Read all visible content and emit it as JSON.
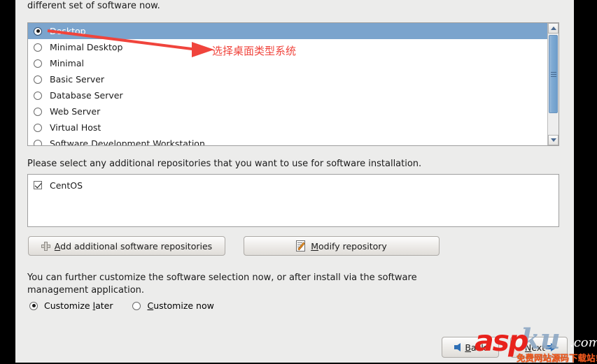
{
  "intro_text": "different set of software now.",
  "software_groups": {
    "items": [
      {
        "label": "Desktop",
        "selected": true
      },
      {
        "label": "Minimal Desktop",
        "selected": false
      },
      {
        "label": "Minimal",
        "selected": false
      },
      {
        "label": "Basic Server",
        "selected": false
      },
      {
        "label": "Database Server",
        "selected": false
      },
      {
        "label": "Web Server",
        "selected": false
      },
      {
        "label": "Virtual Host",
        "selected": false
      },
      {
        "label": "Software Development Workstation",
        "selected": false
      }
    ],
    "scrollbar": {
      "up_icon": "chevron-up-icon",
      "down_icon": "chevron-down-icon"
    }
  },
  "annotation": {
    "text": "选择桌面类型系统",
    "color": "#f0443c",
    "arrow_icon": "red-arrow-icon"
  },
  "repositories": {
    "label": "Please select any additional repositories that you want to use for software installation.",
    "items": [
      {
        "label": "CentOS",
        "checked": true
      }
    ]
  },
  "buttons": {
    "add_repo": {
      "accel": "A",
      "rest": "dd additional software repositories",
      "icon": "plus-icon"
    },
    "modify_repo": {
      "accel": "M",
      "rest": "odify repository",
      "icon": "document-edit-icon"
    },
    "back": {
      "accel": "B",
      "rest": "ack",
      "pre": "",
      "icon": "arrow-left-icon"
    },
    "next": {
      "accel": "N",
      "rest": "ext",
      "icon": "arrow-right-icon"
    }
  },
  "customize": {
    "description": "You can further customize the software selection now, or after install via the software management application.",
    "options": [
      {
        "pre": "Customize ",
        "accel": "l",
        "rest": "ater",
        "selected": true
      },
      {
        "pre": "",
        "accel": "C",
        "rest": "ustomize now",
        "selected": false
      }
    ]
  },
  "watermark": {
    "asp": "asp",
    "ku": "ku",
    "com": ".com",
    "chinese": "免费网站源码下载站!"
  }
}
